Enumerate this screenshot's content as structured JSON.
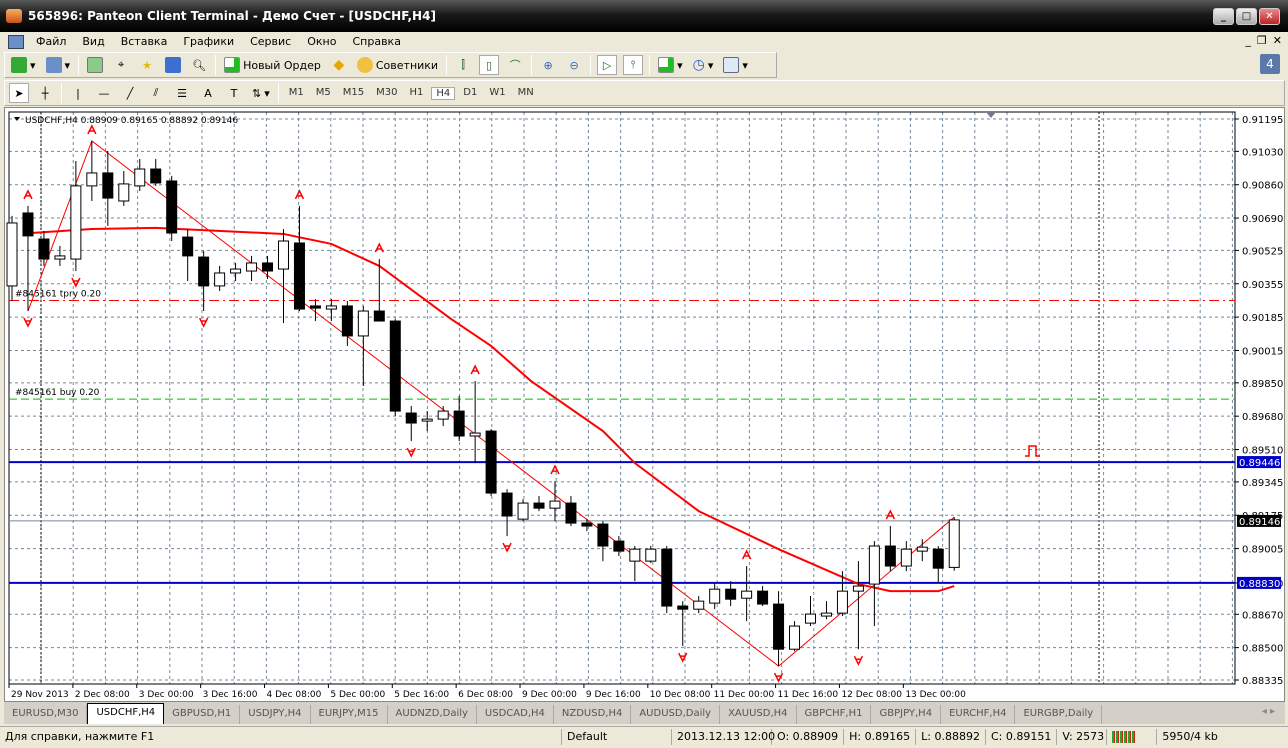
{
  "window": {
    "title": "565896: Panteon Client Terminal - Демо Счет - [USDCHF,H4]"
  },
  "menu": [
    "Файл",
    "Вид",
    "Вставка",
    "Графики",
    "Сервис",
    "Окно",
    "Справка"
  ],
  "toolbar": {
    "new_order": "Новый Ордер",
    "experts": "Советники",
    "notifications": "4"
  },
  "timeframes": [
    "M1",
    "M5",
    "M15",
    "M30",
    "H1",
    "H4",
    "D1",
    "W1",
    "MN"
  ],
  "active_timeframe": "H4",
  "chart": {
    "header": "USDCHF,H4  0.88909 0.89165 0.88892 0.89146",
    "symbol": "USDCHF",
    "period": "H4",
    "price_labels": [
      "0.91195",
      "0.91030",
      "0.90860",
      "0.90690",
      "0.90525",
      "0.90355",
      "0.90185",
      "0.90015",
      "0.89850",
      "0.89680",
      "0.89510",
      "0.89345",
      "0.89175",
      "0.89005",
      "0.88830",
      "0.88670",
      "0.88500",
      "0.88335"
    ],
    "time_labels": [
      "29 Nov 2013",
      "2 Dec 08:00",
      "3 Dec 00:00",
      "3 Dec 16:00",
      "4 Dec 08:00",
      "5 Dec 00:00",
      "5 Dec 16:00",
      "6 Dec 08:00",
      "9 Dec 00:00",
      "9 Dec 16:00",
      "10 Dec 08:00",
      "11 Dec 00:00",
      "11 Dec 16:00",
      "12 Dec 08:00",
      "13 Dec 00:00"
    ],
    "orders": [
      {
        "label": "#845161 tpry 0.20",
        "price": 0.9027,
        "color": "#ff0000"
      },
      {
        "label": "#845161 buy 0.20",
        "price": 0.89767,
        "color": "#00c000"
      }
    ],
    "hlines": [
      {
        "price": 0.89446,
        "label": "0.89446",
        "color": "#0000c8"
      },
      {
        "price": 0.8883,
        "label": "0.88830",
        "color": "#0000c8"
      }
    ],
    "bid": {
      "price": 0.89146,
      "label": "0.89146"
    },
    "colors": {
      "ma": "#ff0000",
      "zigzag": "#ff0000",
      "fractal": "#ff0000",
      "grid": "#778899"
    },
    "candles": [
      [
        0.90344,
        0.90701,
        0.90267,
        0.90665
      ],
      [
        0.90716,
        0.90752,
        0.90216,
        0.90599
      ],
      [
        0.90583,
        0.90624,
        0.90446,
        0.90481
      ],
      [
        0.90481,
        0.90548,
        0.90446,
        0.90497
      ],
      [
        0.90481,
        0.90981,
        0.9042,
        0.90854
      ],
      [
        0.90854,
        0.91083,
        0.90777,
        0.9092
      ],
      [
        0.9092,
        0.91032,
        0.9065,
        0.90792
      ],
      [
        0.90777,
        0.9093,
        0.90752,
        0.90864
      ],
      [
        0.90854,
        0.90991,
        0.90828,
        0.9094
      ],
      [
        0.9094,
        0.90991,
        0.90854,
        0.90869
      ],
      [
        0.90879,
        0.90905,
        0.90573,
        0.90614
      ],
      [
        0.90593,
        0.90634,
        0.90369,
        0.90497
      ],
      [
        0.90491,
        0.90522,
        0.90216,
        0.90344
      ],
      [
        0.90344,
        0.90446,
        0.90318,
        0.9041
      ],
      [
        0.9041,
        0.90461,
        0.90369,
        0.9043
      ],
      [
        0.9042,
        0.90497,
        0.90369,
        0.90461
      ],
      [
        0.90461,
        0.90497,
        0.90379,
        0.9042
      ],
      [
        0.9043,
        0.90634,
        0.90155,
        0.90573
      ],
      [
        0.90563,
        0.90752,
        0.90216,
        0.90226
      ],
      [
        0.90242,
        0.90277,
        0.90165,
        0.90231
      ],
      [
        0.90226,
        0.90277,
        0.90165,
        0.90242
      ],
      [
        0.90242,
        0.90267,
        0.90038,
        0.90089
      ],
      [
        0.90089,
        0.90242,
        0.89834,
        0.90216
      ],
      [
        0.90216,
        0.90481,
        0.90175,
        0.90165
      ],
      [
        0.90165,
        0.90175,
        0.89681,
        0.89706
      ],
      [
        0.89696,
        0.89732,
        0.89553,
        0.89645
      ],
      [
        0.89655,
        0.89706,
        0.89604,
        0.89665
      ],
      [
        0.89665,
        0.89732,
        0.8963,
        0.89706
      ],
      [
        0.89706,
        0.89783,
        0.89553,
        0.89579
      ],
      [
        0.89579,
        0.89859,
        0.89441,
        0.89594
      ],
      [
        0.89604,
        0.89614,
        0.89273,
        0.89288
      ],
      [
        0.89288,
        0.89308,
        0.89069,
        0.89171
      ],
      [
        0.89155,
        0.89257,
        0.89145,
        0.89237
      ],
      [
        0.89237,
        0.89273,
        0.89196,
        0.89211
      ],
      [
        0.89211,
        0.89349,
        0.89145,
        0.89247
      ],
      [
        0.89237,
        0.89273,
        0.8912,
        0.89135
      ],
      [
        0.89135,
        0.89155,
        0.89094,
        0.8912
      ],
      [
        0.8913,
        0.89145,
        0.88941,
        0.89018
      ],
      [
        0.89043,
        0.89069,
        0.88967,
        0.88992
      ],
      [
        0.88941,
        0.89018,
        0.88839,
        0.89002
      ],
      [
        0.88941,
        0.89018,
        0.88931,
        0.89002
      ],
      [
        0.89002,
        0.89018,
        0.88676,
        0.88712
      ],
      [
        0.88712,
        0.88737,
        0.88508,
        0.88696
      ],
      [
        0.88696,
        0.88763,
        0.88676,
        0.88737
      ],
      [
        0.88727,
        0.88829,
        0.88696,
        0.88798
      ],
      [
        0.88798,
        0.88839,
        0.88712,
        0.88747
      ],
      [
        0.88752,
        0.88916,
        0.88635,
        0.88788
      ],
      [
        0.88788,
        0.88814,
        0.88712,
        0.88722
      ],
      [
        0.88722,
        0.88788,
        0.88406,
        0.88492
      ],
      [
        0.88492,
        0.88635,
        0.88482,
        0.8861
      ],
      [
        0.88625,
        0.88763,
        0.8861,
        0.88671
      ],
      [
        0.88661,
        0.88737,
        0.88645,
        0.88676
      ],
      [
        0.88676,
        0.8889,
        0.88661,
        0.88788
      ],
      [
        0.88788,
        0.88941,
        0.88492,
        0.88814
      ],
      [
        0.88824,
        0.89043,
        0.8861,
        0.89018
      ],
      [
        0.89018,
        0.8912,
        0.8889,
        0.88916
      ],
      [
        0.88916,
        0.89043,
        0.8889,
        0.89002
      ],
      [
        0.88992,
        0.89053,
        0.88941,
        0.89012
      ],
      [
        0.89002,
        0.89018,
        0.88829,
        0.88905
      ],
      [
        0.88909,
        0.89165,
        0.88892,
        0.89151
      ]
    ],
    "ma": [
      [
        1.2,
        0.90614
      ],
      [
        5,
        0.90634
      ],
      [
        9,
        0.9064
      ],
      [
        17,
        0.90609
      ],
      [
        20,
        0.90558
      ],
      [
        23,
        0.90446
      ],
      [
        27.5,
        0.90175
      ],
      [
        30,
        0.90038
      ],
      [
        32.5,
        0.89859
      ],
      [
        37,
        0.89604
      ],
      [
        39,
        0.89441
      ],
      [
        43,
        0.89196
      ],
      [
        48,
        0.89002
      ],
      [
        53,
        0.88824
      ],
      [
        55,
        0.88788
      ],
      [
        58,
        0.88788
      ],
      [
        59,
        0.88814
      ]
    ],
    "zigzag": [
      [
        1,
        0.90216
      ],
      [
        5,
        0.91083
      ],
      [
        48,
        0.88406
      ],
      [
        59,
        0.89165
      ]
    ],
    "fractals_up": [
      1,
      5,
      18,
      23,
      29,
      34,
      46,
      55
    ],
    "fractals_down": [
      1,
      4,
      12,
      25,
      31,
      42,
      48,
      53
    ]
  },
  "tabs": [
    "EURUSD,M30",
    "USDCHF,H4",
    "GBPUSD,H1",
    "USDJPY,H4",
    "EURJPY,M15",
    "AUDNZD,Daily",
    "USDCAD,H4",
    "NZDUSD,H4",
    "AUDUSD,Daily",
    "XAUUSD,H4",
    "GBPCHF,H1",
    "GBPJPY,H4",
    "EURCHF,H4",
    "EURGBP,Daily"
  ],
  "active_tab": "USDCHF,H4",
  "status": {
    "help": "Для справки, нажмите F1",
    "profile": "Default",
    "time": "2013.12.13 12:00",
    "open": "O: 0.88909",
    "high": "H: 0.89165",
    "low": "L: 0.88892",
    "close": "C: 0.89151",
    "volume": "V: 2573",
    "traffic": "5950/4 kb"
  }
}
